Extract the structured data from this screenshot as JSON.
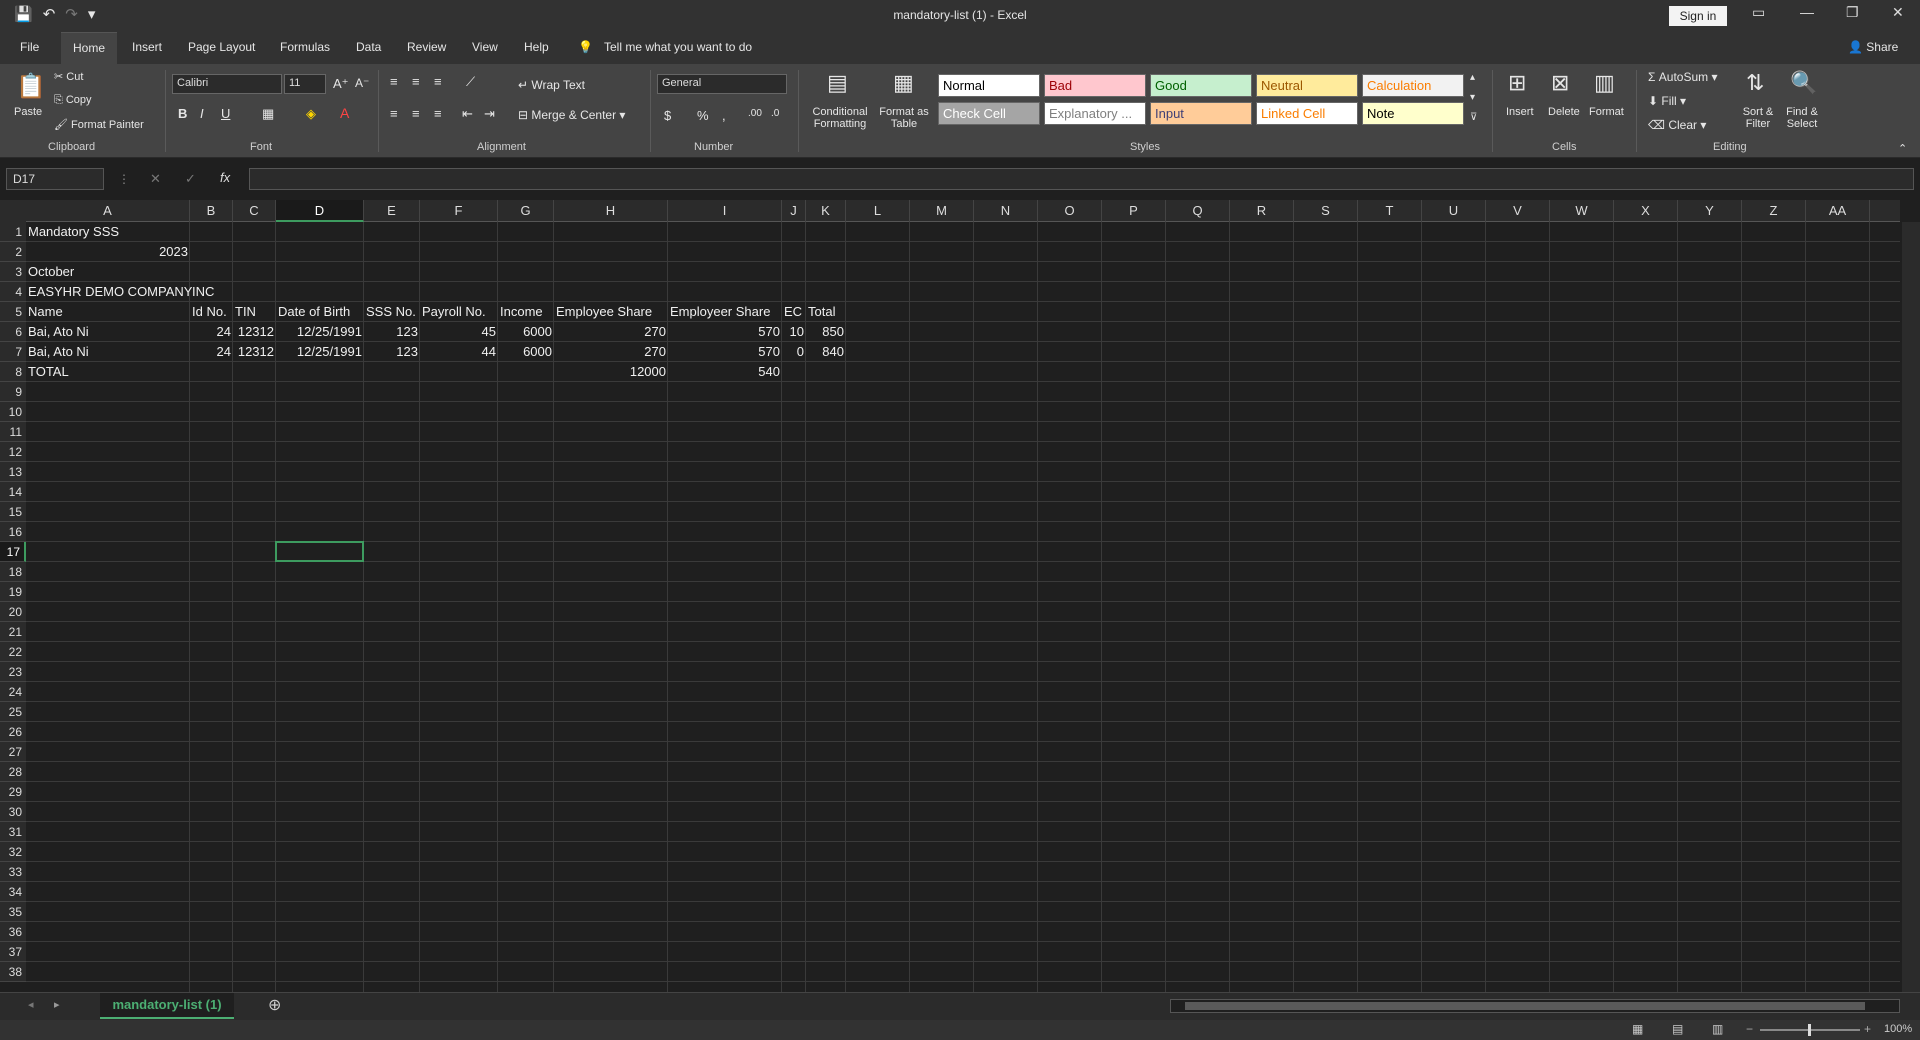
{
  "window": {
    "title": "mandatory-list (1)  -  Excel",
    "sign_in": "Sign in",
    "share": "Share"
  },
  "tabs": [
    "File",
    "Home",
    "Insert",
    "Page Layout",
    "Formulas",
    "Data",
    "Review",
    "View",
    "Help"
  ],
  "tell_me": "Tell me what you want to do",
  "ribbon": {
    "clipboard": {
      "label": "Clipboard",
      "paste": "Paste",
      "cut": "Cut",
      "copy": "Copy",
      "format_painter": "Format Painter"
    },
    "font": {
      "label": "Font",
      "name": "Calibri",
      "size": "11"
    },
    "alignment": {
      "label": "Alignment",
      "wrap": "Wrap Text",
      "merge": "Merge & Center"
    },
    "number": {
      "label": "Number",
      "format": "General"
    },
    "styles": {
      "label": "Styles",
      "conditional": "Conditional Formatting",
      "format_table": "Format as Table",
      "items": [
        {
          "name": "Normal",
          "bg": "#ffffff",
          "fg": "#000000"
        },
        {
          "name": "Bad",
          "bg": "#ffc7ce",
          "fg": "#9c0006"
        },
        {
          "name": "Good",
          "bg": "#c6efce",
          "fg": "#006100"
        },
        {
          "name": "Neutral",
          "bg": "#ffeb9c",
          "fg": "#9c5700"
        },
        {
          "name": "Calculation",
          "bg": "#f2f2f2",
          "fg": "#fa7d00"
        },
        {
          "name": "Check Cell",
          "bg": "#a5a5a5",
          "fg": "#ffffff"
        },
        {
          "name": "Explanatory ...",
          "bg": "#ffffff",
          "fg": "#7f7f7f"
        },
        {
          "name": "Input",
          "bg": "#ffcc99",
          "fg": "#3f3f76"
        },
        {
          "name": "Linked Cell",
          "bg": "#ffffff",
          "fg": "#fa7d00"
        },
        {
          "name": "Note",
          "bg": "#ffffcc",
          "fg": "#000000"
        }
      ]
    },
    "cells": {
      "label": "Cells",
      "insert": "Insert",
      "delete": "Delete",
      "format": "Format"
    },
    "editing": {
      "label": "Editing",
      "autosum": "AutoSum",
      "fill": "Fill",
      "clear": "Clear",
      "sort": "Sort & Filter",
      "find": "Find & Select"
    }
  },
  "formula_bar": {
    "name_box": "D17",
    "fx": "fx",
    "content": ""
  },
  "columns": [
    "A",
    "B",
    "C",
    "D",
    "E",
    "F",
    "G",
    "H",
    "I",
    "J",
    "K",
    "L",
    "M",
    "N",
    "O",
    "P",
    "Q",
    "R",
    "S",
    "T",
    "U",
    "V",
    "W",
    "X",
    "Y",
    "Z",
    "AA"
  ],
  "rows": [
    "1",
    "2",
    "3",
    "4",
    "5",
    "6",
    "7",
    "8",
    "9",
    "10",
    "11",
    "12",
    "13",
    "14",
    "15",
    "16",
    "17",
    "18",
    "19",
    "20",
    "21",
    "22",
    "23",
    "24",
    "25",
    "26",
    "27",
    "28",
    "29",
    "30",
    "31",
    "32",
    "33",
    "34",
    "35",
    "36",
    "37",
    "38"
  ],
  "sheet": {
    "r1": {
      "A": "Mandatory SSS"
    },
    "r2": {
      "A": "2023"
    },
    "r3": {
      "A": "October"
    },
    "r4": {
      "A": "EASYHR DEMO COMPANY",
      "B": "INC"
    },
    "r5": {
      "A": "Name",
      "B": "Id No.",
      "C": "TIN",
      "D": "Date of Birth",
      "E": "SSS No.",
      "F": "Payroll No.",
      "G": "Income",
      "H": "Employee Share",
      "I": "Employeer Share",
      "J": "EC",
      "K": "Total"
    },
    "r6": {
      "A": "Bai, Ato Ni",
      "B": "24",
      "C": "12312",
      "D": "12/25/1991",
      "E": "123",
      "F": "45",
      "G": "6000",
      "H": "270",
      "I": "570",
      "J": "10",
      "K": "850"
    },
    "r7": {
      "A": "Bai, Ato Ni",
      "B": "24",
      "C": "12312",
      "D": "12/25/1991",
      "E": "123",
      "F": "44",
      "G": "6000",
      "H": "270",
      "I": "570",
      "J": "0",
      "K": "840"
    },
    "r8": {
      "A": "TOTAL",
      "H": "12000",
      "I": "540"
    }
  },
  "sheet_tab": "mandatory-list (1)",
  "zoom": "100%"
}
